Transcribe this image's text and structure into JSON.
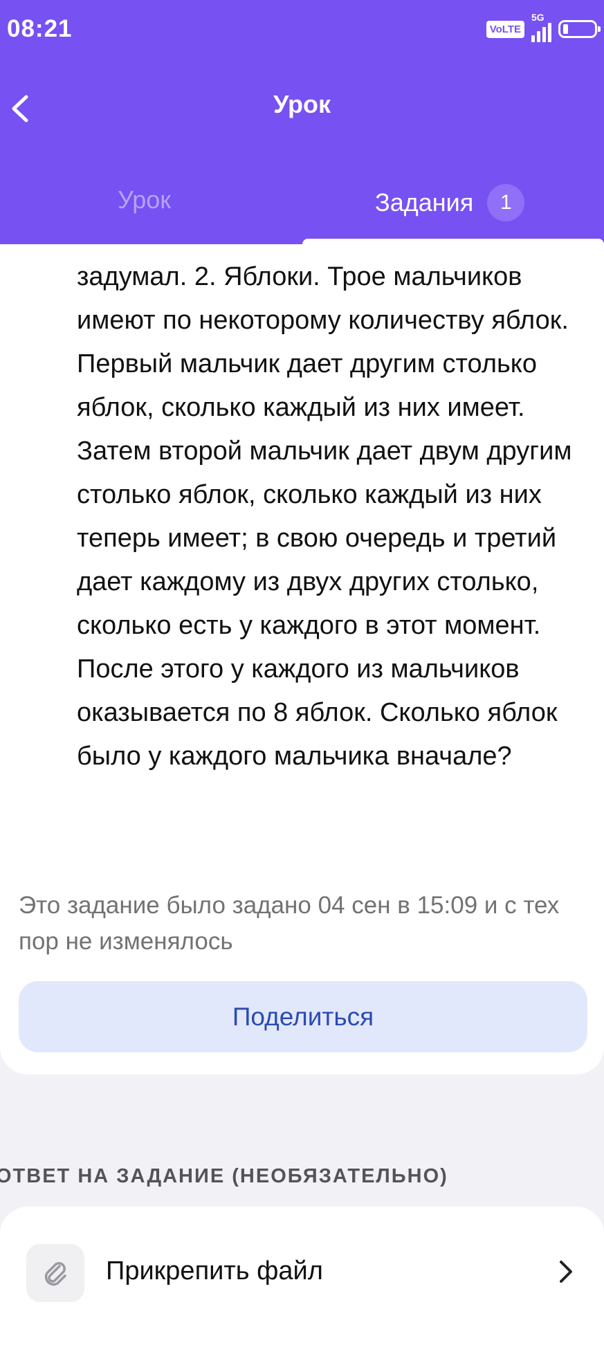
{
  "status_bar": {
    "time": "08:21",
    "volte": "VoLTE",
    "network": "5G"
  },
  "header": {
    "title": "Урок"
  },
  "tabs": [
    {
      "label": "Урок"
    },
    {
      "label": "Задания",
      "badge": "1"
    }
  ],
  "task": {
    "text": "задумал.  2. Яблоки. Трое мальчиков имеют по некоторому количеству яблок. Первый мальчик дает другим столько яблок, сколько каждый из них имеет. Затем второй мальчик дает двум другим столько яблок, сколько каждый из них теперь имеет; в свою очередь и третий дает каждому из двух других столько, сколько есть у каждого в этот момент. После этого у каждого из мальчиков оказывается по 8 яблок. Сколько яблок было у каждого мальчика вначале?",
    "meta": "Это задание было задано 04 сен в 15:09 и с тех пор не изменялось",
    "share_label": "Поделиться"
  },
  "answer": {
    "section_label": "ОТВЕТ НА ЗАДАНИЕ (НЕОБЯЗАТЕЛЬНО)",
    "attach_label": "Прикрепить файл"
  },
  "colors": {
    "header": "#7751f2",
    "share_bg": "#e2e8fc",
    "share_text": "#2b4bb3"
  }
}
